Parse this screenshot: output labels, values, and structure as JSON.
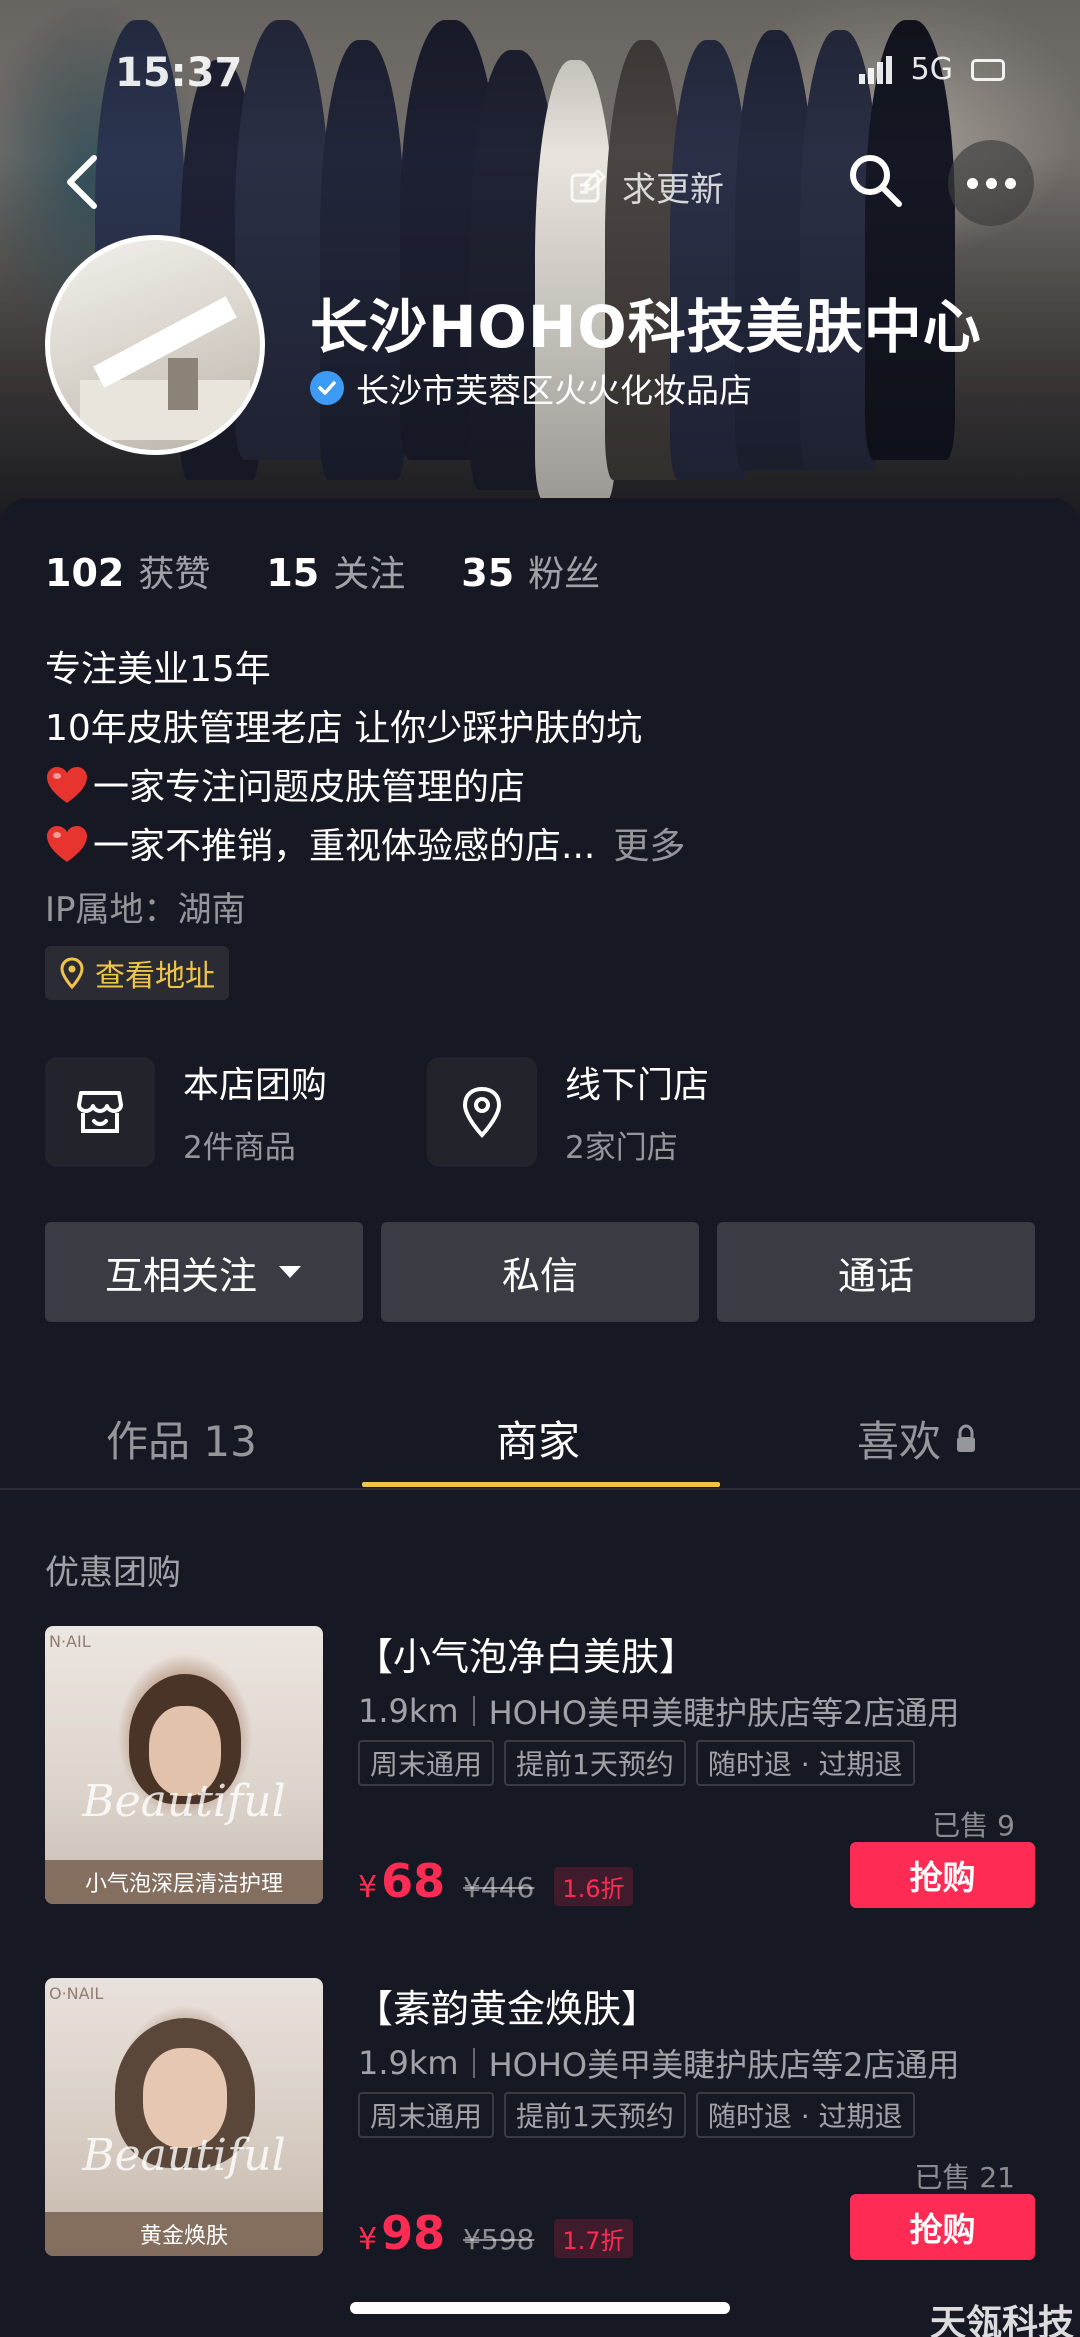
{
  "status_bar": {
    "time": "15:37",
    "network": "5G"
  },
  "header": {
    "update_label": "求更新"
  },
  "profile": {
    "name": "长沙HOHO科技美肤中心",
    "verified_text": "长沙市芙蓉区火火化妆品店",
    "stats": [
      {
        "value": "102",
        "label": "获赞"
      },
      {
        "value": "15",
        "label": "关注"
      },
      {
        "value": "35",
        "label": "粉丝"
      }
    ],
    "bio": [
      "专注美业15年",
      "10年皮肤管理老店 让你少踩护肤的坑",
      "一家专注问题皮肤管理的店",
      "一家不推销，重视体验感的店..."
    ],
    "bio_more": "更多",
    "ip": "IP属地：湖南",
    "address_button": "查看地址"
  },
  "services": [
    {
      "title": "本店团购",
      "subtitle": "2件商品"
    },
    {
      "title": "线下门店",
      "subtitle": "2家门店"
    }
  ],
  "actions": {
    "follow": "互相关注",
    "message": "私信",
    "call": "通话"
  },
  "tabs": [
    {
      "label": "作品 13"
    },
    {
      "label": "商家"
    },
    {
      "label": "喜欢"
    }
  ],
  "section_title": "优惠团购",
  "deals": [
    {
      "title": "【小气泡净白美肤】",
      "distance": "1.9km",
      "stores": "HOHO美甲美睫护肤店等2店通用",
      "tags": [
        "周末通用",
        "提前1天预约",
        "随时退 · 过期退"
      ],
      "sold": "已售 9",
      "currency": "¥",
      "price": "68",
      "original": "¥446",
      "discount": "1.6折",
      "buy": "抢购",
      "thumb_script": "Beautiful",
      "thumb_caption": "小气泡深层清洁护理",
      "thumb_brand": "N·AIL"
    },
    {
      "title": "【素韵黄金焕肤】",
      "distance": "1.9km",
      "stores": "HOHO美甲美睫护肤店等2店通用",
      "tags": [
        "周末通用",
        "提前1天预约",
        "随时退 · 过期退"
      ],
      "sold": "已售 21",
      "currency": "¥",
      "price": "98",
      "original": "¥598",
      "discount": "1.7折",
      "buy": "抢购",
      "thumb_script": "Beautiful",
      "thumb_caption": "黄金焕肤",
      "thumb_brand": "O·NAIL"
    }
  ],
  "watermark": "天瓴科技",
  "colors": {
    "accent_red": "#fe2c55",
    "tab_indicator": "#f0c44a",
    "background": "#161823",
    "verified_blue": "#3d9bf5"
  }
}
